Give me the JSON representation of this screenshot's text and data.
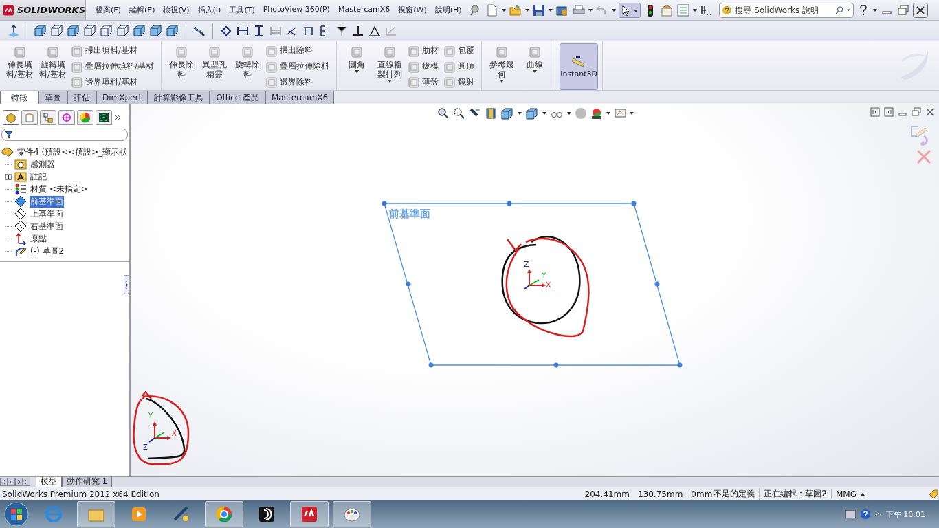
{
  "app": {
    "logo": "SOLIDWORKS"
  },
  "menu": [
    "檔案(F)",
    "編輯(E)",
    "檢視(V)",
    "插入(I)",
    "工具(T)",
    "PhotoView 360(P)",
    "MastercamX6",
    "視窗(W)",
    "說明(H)"
  ],
  "search": {
    "placeholder": "搜尋 SolidWorks 說明"
  },
  "ribbon": {
    "groups": [
      {
        "items": [
          {
            "kind": "large",
            "label": "伸長填料/基材",
            "dropdown": false
          },
          {
            "kind": "large",
            "label": "旋轉填料/基材",
            "dropdown": false
          },
          {
            "kind": "small",
            "labels": [
              "掃出填料/基材",
              "疊層拉伸填料/基材",
              "邊界填料/基材"
            ]
          }
        ]
      },
      {
        "items": [
          {
            "kind": "large",
            "label": "伸長除料",
            "dropdown": false
          },
          {
            "kind": "large",
            "label": "異型孔精靈",
            "dropdown": false
          },
          {
            "kind": "large",
            "label": "旋轉除料",
            "dropdown": false
          },
          {
            "kind": "small",
            "labels": [
              "掃出除料",
              "疊層拉伸除料",
              "邊界除料"
            ]
          }
        ]
      },
      {
        "items": [
          {
            "kind": "large",
            "label": "圓角",
            "dropdown": true
          },
          {
            "kind": "large",
            "label": "直線複製排列",
            "dropdown": true
          },
          {
            "kind": "small",
            "labels": [
              "肋材",
              "拔模",
              "薄殼"
            ]
          },
          {
            "kind": "small",
            "labels": [
              "包覆",
              "圓頂",
              "鏡射"
            ]
          }
        ]
      },
      {
        "items": [
          {
            "kind": "large",
            "label": "參考幾何",
            "dropdown": true
          },
          {
            "kind": "large",
            "label": "曲線",
            "dropdown": true
          }
        ]
      },
      {
        "items": [
          {
            "kind": "toggle",
            "label": "Instant3D",
            "selected": true
          }
        ]
      }
    ]
  },
  "tabs": [
    {
      "label": "特徵",
      "selected": true
    },
    {
      "label": "草圖",
      "selected": false
    },
    {
      "label": "評估",
      "selected": false
    },
    {
      "label": "DimXpert",
      "selected": false
    },
    {
      "label": "計算影像工具",
      "selected": false
    },
    {
      "label": "Office 產品",
      "selected": false
    },
    {
      "label": "MastercamX6",
      "selected": false
    }
  ],
  "panel_tabs": [
    {
      "selected": true
    },
    {
      "selected": false
    },
    {
      "selected": false
    },
    {
      "selected": false
    },
    {
      "selected": false
    },
    {
      "selected": false
    }
  ],
  "tree": {
    "kind": "part",
    "label": "零件4 (預設<<預設>_顯示狀",
    "children": [
      {
        "kind": "sensor",
        "label": "感測器",
        "selected": false
      },
      {
        "kind": "annotation",
        "label": "註記",
        "selected": false,
        "expanded": false
      },
      {
        "kind": "material",
        "label": "材質 <未指定>",
        "selected": false
      },
      {
        "kind": "plane",
        "label": "前基準面",
        "selected": true
      },
      {
        "kind": "plane",
        "label": "上基準面",
        "selected": false
      },
      {
        "kind": "plane",
        "label": "右基準面",
        "selected": false
      },
      {
        "kind": "origin",
        "label": "原點",
        "selected": false
      },
      {
        "kind": "sketch",
        "label": "(-) 草圖2",
        "selected": false
      }
    ]
  },
  "graphics": {
    "plane_label": "前基準面",
    "sketch_triad": {
      "x": "X",
      "y": "Y",
      "z": "Z"
    },
    "corner_triad": {
      "x": "X",
      "y": "Y",
      "z": "Z"
    }
  },
  "bottom_tabs": [
    {
      "label": "模型",
      "selected": true
    },
    {
      "label": "動作研究 1",
      "selected": false
    }
  ],
  "status_bar": {
    "edition": "SolidWorks Premium 2012 x64 Edition",
    "x": "204.41mm",
    "y": "130.75mm",
    "z": "0mm",
    "state": "不足的定義",
    "editing": "正在編輯：草圖2",
    "units": "MMG"
  },
  "taskbar": {
    "clock": "下午 10:01"
  }
}
